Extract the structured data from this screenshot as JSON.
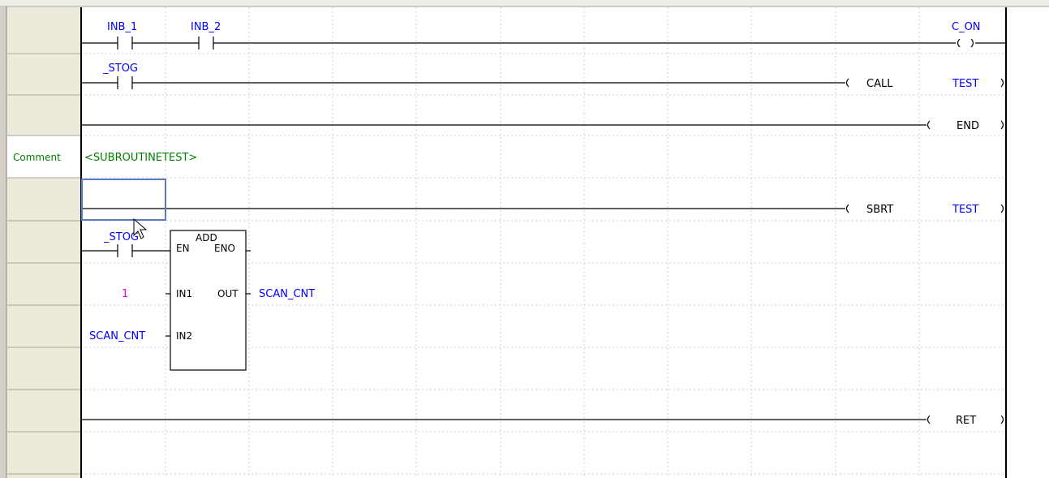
{
  "margin": {
    "comment_label": "Comment"
  },
  "comment": {
    "text": "<SUBROUTINETEST>"
  },
  "rungs": {
    "r1": {
      "contact1": "INB_1",
      "contact2": "INB_2",
      "coil": "C_ON"
    },
    "r2": {
      "contact": "_STOG",
      "instruction": "CALL",
      "operand": "TEST"
    },
    "r3": {
      "instruction": "END"
    },
    "r5": {
      "instruction": "SBRT",
      "operand": "TEST"
    },
    "r6": {
      "contact": "_STOG",
      "block_name": "ADD",
      "pin_en": "EN",
      "pin_eno": "ENO",
      "pin_in1": "IN1",
      "pin_in2": "IN2",
      "pin_out": "OUT",
      "in1_value": "1",
      "in2_value": "SCAN_CNT",
      "out_value": "SCAN_CNT"
    },
    "r8": {
      "instruction": "RET"
    }
  },
  "colors": {
    "margin_bg": "#eceadb",
    "variable": "#0000ff",
    "comment": "#008000",
    "constant": "#e000e0",
    "selection": "#5a7bc0"
  },
  "icons": {
    "cursor": "arrow-cursor-icon"
  }
}
